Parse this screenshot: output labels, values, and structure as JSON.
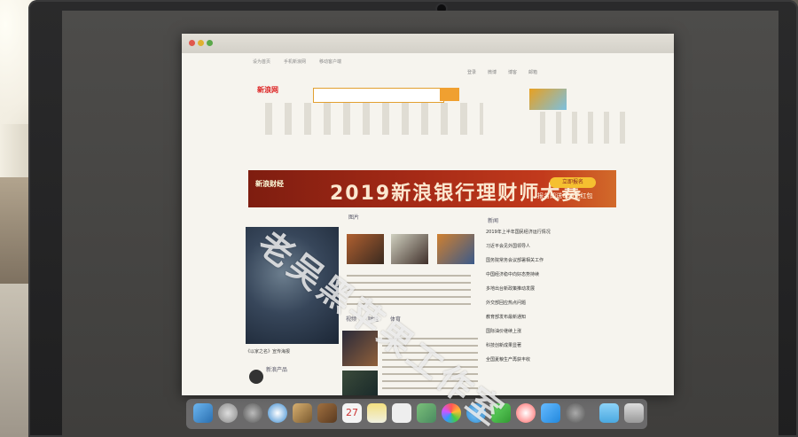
{
  "browser": {
    "title": "",
    "site_logo": "新浪网",
    "search_placeholder": "",
    "topbar_links": [
      "设为首页",
      "手机新浪网",
      "移动客户端"
    ],
    "top_right": [
      "登录",
      "微博",
      "博客",
      "邮箱"
    ]
  },
  "ad": {
    "logo": "新浪财经",
    "title": "2019新浪银行理财师大赛",
    "button": "立即报名",
    "subtitle": "报名即送666元红包"
  },
  "tabs": {
    "pics": "图片",
    "news": "新闻",
    "video": "视频",
    "finance": "财经",
    "sports": "体育"
  },
  "photo_caption": "《以家之名》宣传海报",
  "products_title": "新浪产品",
  "news_headlines": [
    "2019年上半年国民经济运行情况",
    "习近平会见外国领导人",
    "国务院常务会议部署相关工作",
    "中国经济稳中向好态势持续",
    "多地出台新政策推动发展",
    "外交部回应热点问题",
    "教育部发布最新通知",
    "国际油价继续上涨",
    "科技创新成果显著",
    "全国夏粮生产再获丰收"
  ],
  "watermark": "老吴黑苹果工作室",
  "dock_apps": [
    "finder",
    "launchpad",
    "rocket",
    "safari",
    "photos",
    "notes",
    "calendar",
    "notes2",
    "reminders",
    "maps",
    "photos2",
    "messages",
    "facetime",
    "itunes",
    "appstore",
    "preferences",
    "folder",
    "trash"
  ]
}
